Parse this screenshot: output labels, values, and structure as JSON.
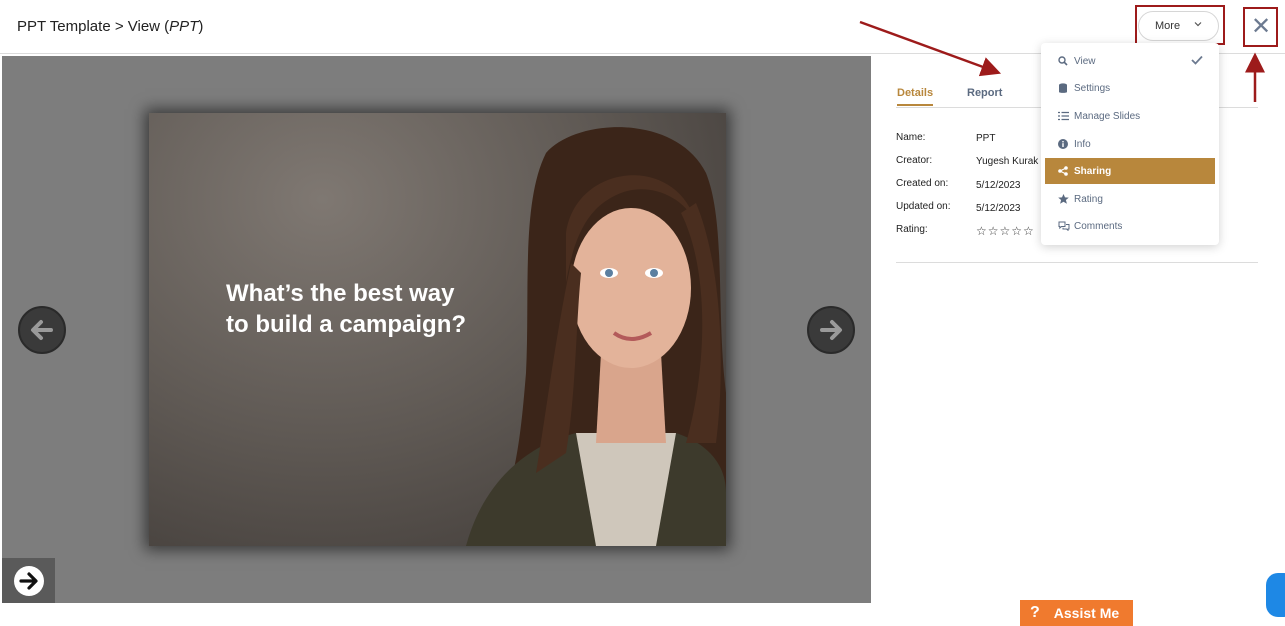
{
  "header": {
    "breadcrumb_prefix": "PPT Template > View (",
    "breadcrumb_item": "PPT",
    "breadcrumb_suffix": ")",
    "more_label": "More"
  },
  "slide": {
    "line1": "What’s the best way",
    "line2": "to build a campaign?"
  },
  "tabs": {
    "details": "Details",
    "report": "Report"
  },
  "details": {
    "name_label": "Name:",
    "name_value": "PPT",
    "creator_label": "Creator:",
    "creator_value": "Yugesh Kurak",
    "created_label": "Created on:",
    "created_value": "5/12/2023",
    "updated_label": "Updated on:",
    "updated_value": "5/12/2023",
    "rating_label": "Rating:",
    "rating_stars": "☆☆☆☆☆"
  },
  "menu": {
    "items": [
      {
        "label": "View",
        "icon": "search-icon",
        "checked": true
      },
      {
        "label": "Settings",
        "icon": "database-icon"
      },
      {
        "label": "Manage Slides",
        "icon": "list-icon"
      },
      {
        "label": "Info",
        "icon": "info-icon"
      },
      {
        "label": "Sharing",
        "icon": "share-icon",
        "active": true
      },
      {
        "label": "Rating",
        "icon": "star-icon"
      },
      {
        "label": "Comments",
        "icon": "comments-icon"
      }
    ]
  },
  "assist": {
    "label": "Assist Me",
    "q": "?"
  },
  "colors": {
    "accent": "#b8873c",
    "annotation": "#9d1b1b",
    "assist": "#f07a2e"
  }
}
